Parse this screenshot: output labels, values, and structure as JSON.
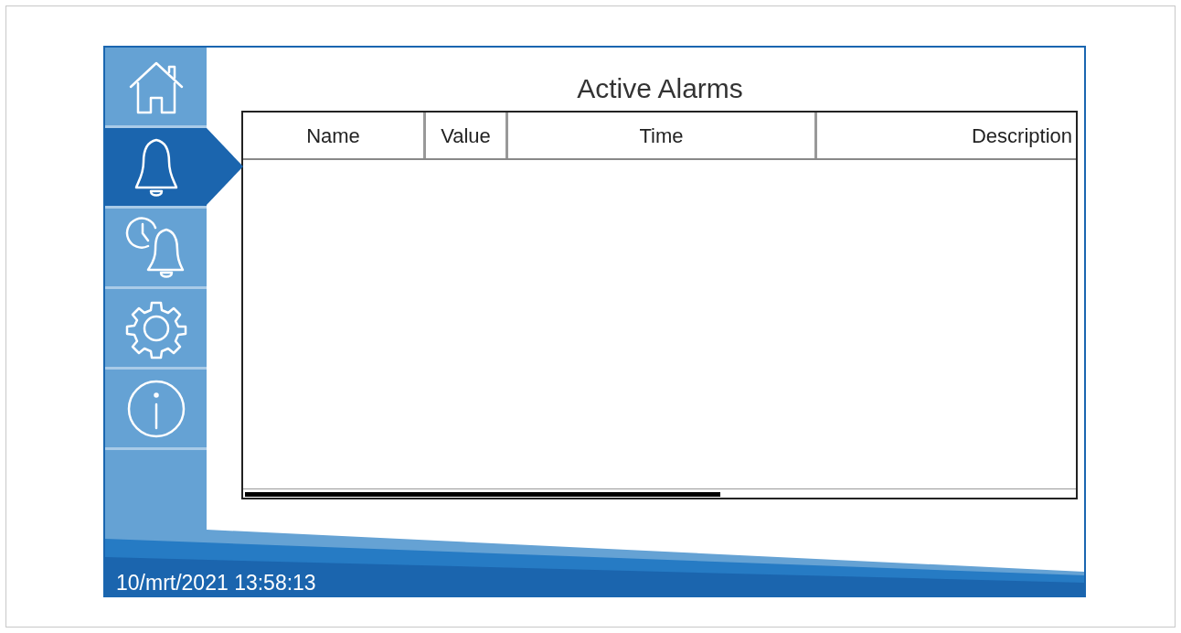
{
  "nav": [
    {
      "kind": "home",
      "selected": false
    },
    {
      "kind": "alarms",
      "selected": true
    },
    {
      "kind": "history",
      "selected": false
    },
    {
      "kind": "settings",
      "selected": false
    },
    {
      "kind": "info",
      "selected": false
    }
  ],
  "title": "Active Alarms",
  "table": {
    "columns": [
      {
        "label": "Name"
      },
      {
        "label": "Value"
      },
      {
        "label": "Time"
      },
      {
        "label": "Description"
      }
    ]
  },
  "status_bar": {
    "datetime": "10/mrt/2021 13:58:13"
  }
}
